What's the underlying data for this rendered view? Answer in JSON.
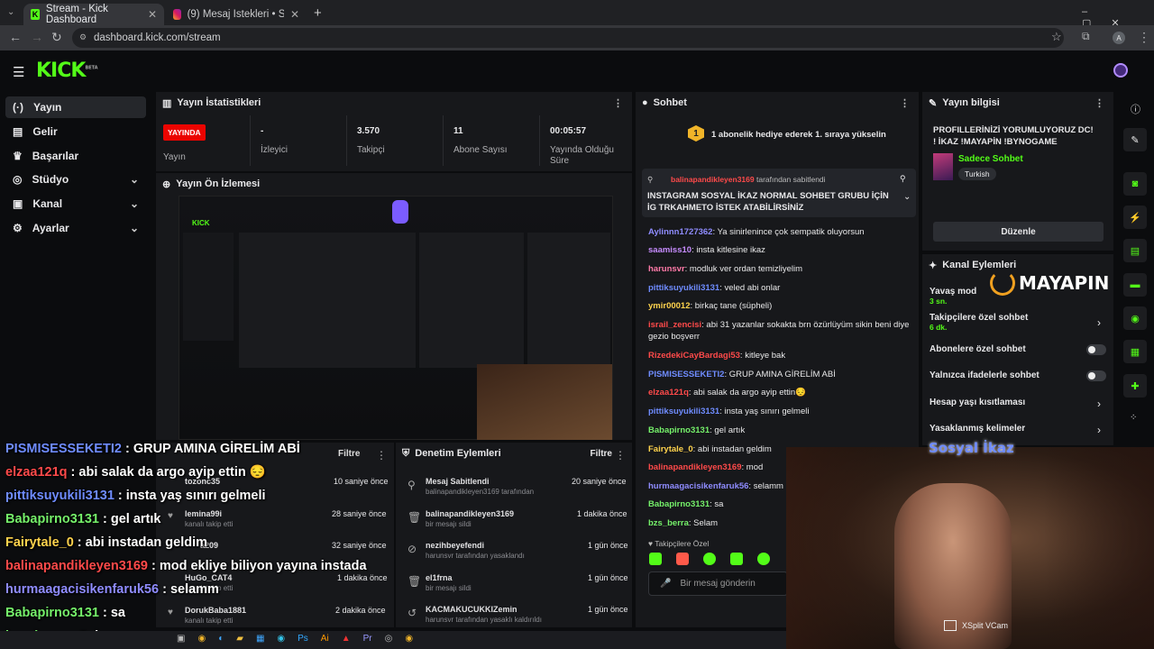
{
  "browser": {
    "tabs": [
      {
        "label": "Stream - Kick Dashboard"
      },
      {
        "label": "(9) Mesaj İstekleri • Sohbetler"
      }
    ],
    "url": "dashboard.kick.com/stream"
  },
  "brand": {
    "logo": "KICK",
    "beta": "BETA"
  },
  "sidebar": {
    "items": [
      {
        "label": "Yayın"
      },
      {
        "label": "Gelir"
      },
      {
        "label": "Başarılar"
      },
      {
        "label": "Stüdyo"
      },
      {
        "label": "Kanal"
      },
      {
        "label": "Ayarlar"
      }
    ]
  },
  "stats": {
    "title": "Yayın İstatistikleri",
    "live_badge": "YAYINDA",
    "live_label": "Yayın",
    "items": [
      {
        "value": "-",
        "label": "İzleyici"
      },
      {
        "value": "3.570",
        "label": "Takipçi"
      },
      {
        "value": "11",
        "label": "Abone Sayısı"
      },
      {
        "value": "00:05:57",
        "label": "Yayında Olduğu Süre"
      }
    ]
  },
  "preview": {
    "title": "Yayın Ön İzlemesi"
  },
  "followers_panel": {
    "filter": "Filtre",
    "rows": [
      {
        "name": "tozonc35",
        "sub": "",
        "time": "10 saniye önce"
      },
      {
        "name": "lemina99i",
        "sub": "kanalı takip etti",
        "time": "28 saniye önce"
      },
      {
        "name": "a209",
        "sub": "",
        "time": "32 saniye önce"
      },
      {
        "name": "HuGo_CAT4",
        "sub": "kanalı takip etti",
        "time": "1 dakika önce"
      },
      {
        "name": "DorukBaba1881",
        "sub": "kanalı takip etti",
        "time": "2 dakika önce"
      }
    ]
  },
  "moderation": {
    "title": "Denetim Eylemleri",
    "filter": "Filtre",
    "rows": [
      {
        "name": "Mesaj Sabitlendi",
        "sub": "balinapandikleyen3169 tarafından",
        "time": "20 saniye önce"
      },
      {
        "name": "balinapandikleyen3169",
        "sub": "bir mesajı sildi",
        "time": "1 dakika önce"
      },
      {
        "name": "nezihbeyefendi",
        "sub": "harunsvr tarafından yasaklandı",
        "time": "1 gün önce"
      },
      {
        "name": "el1frna",
        "sub": "bir mesajı sildi",
        "time": "1 gün önce"
      },
      {
        "name": "KACMAKUCUKKIZemin",
        "sub": "harunsvr tarafından yasaklı kaldırıldı",
        "time": "1 gün önce"
      }
    ]
  },
  "chat": {
    "title": "Sohbet",
    "goal": "1 abonelik hediye ederek 1. sıraya yükselin",
    "goal_rank": "1",
    "pinned_by": "balinapandikleyen3169",
    "pinned_suffix": "tarafından sabitlendi",
    "pinned_text": "INSTAGRAM SOSYAL İKAZ NORMAL SOHBET GRUBU İÇİN İG TRKAHMETO İSTEK ATABİLİRSİNİZ",
    "messages": [
      {
        "user": "Aylinnn1727362",
        "text": ": Ya sinirlenince çok sempatik oluyorsun",
        "color": "#8f8cff"
      },
      {
        "user": "saamiss10",
        "text": ": insta kitlesine ikaz",
        "color": "#c78cff"
      },
      {
        "user": "harunsvr",
        "text": ": modluk ver ordan temizliyelim",
        "color": "#ff7aa8"
      },
      {
        "user": "pittiksuyukili3131",
        "text": ": veled abi onlar",
        "color": "#6f8cff"
      },
      {
        "user": "ymir00012",
        "text": ": birkaç tane (süpheli)",
        "color": "#ffd34d"
      },
      {
        "user": "israil_zencisi",
        "text": ": abi 31 yazanlar sokakta brn özürlüyüm sikin beni diye gezio boşverr",
        "color": "#ff4a4a"
      },
      {
        "user": "RizedekiCayBardagi53",
        "text": ": kitleye bak",
        "color": "#ff4a4a"
      },
      {
        "user": "PISMISESSEKETI2",
        "text": ": GRUP AMINA GİRELİM ABİ",
        "color": "#6f8cff"
      },
      {
        "user": "elzaa121q",
        "text": ": abi salak da argo ayip ettin😔",
        "color": "#ff4a4a"
      },
      {
        "user": "pittiksuyukili3131",
        "text": ": insta yaş sınırı gelmeli",
        "color": "#6f8cff"
      },
      {
        "user": "Babapirno3131",
        "text": ": gel artık",
        "color": "#75f06a"
      },
      {
        "user": "Fairytale_0",
        "text": ": abi instadan geldim",
        "color": "#ffd34d"
      },
      {
        "user": "balinapandikleyen3169",
        "text": ": mod",
        "color": "#ff4a4a"
      },
      {
        "user": "hurmaagacisikenfaruk56",
        "text": ": selamm",
        "color": "#8f8cff"
      },
      {
        "user": "Babapirno3131",
        "text": ": sa",
        "color": "#75f06a"
      },
      {
        "user": "bzs_berra",
        "text": ": Selam",
        "color": "#75f06a"
      }
    ],
    "followers_only": "Takipçilere Özel",
    "input_placeholder": "Bir mesaj gönderin"
  },
  "overlay_chat": [
    {
      "user": "PISMISESSEKETI2",
      "text": " : GRUP AMINA GİRELİM ABİ",
      "color": "#6f8cff"
    },
    {
      "user": "elzaa121q",
      "text": " : abi salak da argo ayip ettin 😔",
      "color": "#ff4a4a"
    },
    {
      "user": "pittiksuyukili3131",
      "text": " : insta yaş sınırı gelmeli",
      "color": "#6f8cff"
    },
    {
      "user": "Babapirno3131",
      "text": " : gel artık",
      "color": "#75f06a"
    },
    {
      "user": "Fairytale_0",
      "text": " : abi instadan geldim",
      "color": "#ffd34d"
    },
    {
      "user": "balinapandikleyen3169",
      "text": " : mod ekliye biliyon yayına instada",
      "color": "#ff4a4a"
    },
    {
      "user": "hurmaagacisikenfaruk56",
      "text": " : selamm",
      "color": "#8f8cff"
    },
    {
      "user": "Babapirno3131",
      "text": " : sa",
      "color": "#75f06a"
    },
    {
      "user": "bzs_berra",
      "text": " : Selam",
      "color": "#75f06a"
    }
  ],
  "info": {
    "title": "Yayın bilgisi",
    "stream_title": "PROFILLERİNİZİ YORUMLUYORUZ DC! ! İKAZ !MAYAPİN !BYNOGAME",
    "category": "Sadece Sohbet",
    "tag": "Turkish",
    "edit": "Düzenle"
  },
  "channel_actions": {
    "title": "Kanal Eylemleri",
    "items": [
      {
        "label": "Yavaş mod",
        "sub": "3 sn."
      },
      {
        "label": "Takipçilere özel sohbet",
        "sub": "6 dk."
      },
      {
        "label": "Abonelere özel sohbet",
        "sub": ""
      },
      {
        "label": "Yalnızca ifadelerle sohbet",
        "sub": ""
      },
      {
        "label": "Hesap yaşı kısıtlaması",
        "sub": ""
      },
      {
        "label": "Yasaklanmış kelimeler",
        "sub": ""
      }
    ]
  },
  "overlay": {
    "sponsor": "MAYAPIN",
    "webcam_label": "Sosyal İkaz",
    "vcam": "XSplit VCam"
  },
  "colors": {
    "accent": "#53fc18",
    "live": "#eb0400",
    "panel": "#17181b"
  }
}
